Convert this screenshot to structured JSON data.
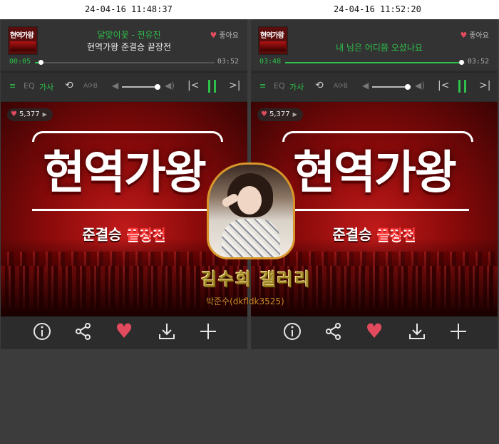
{
  "timestamps": {
    "left": "24-04-16 11:48:37",
    "right": "24-04-16 11:52:20"
  },
  "panels": [
    {
      "thumb": {
        "line1": "현역가왕"
      },
      "line1": "달맞이꽃 - 전유진",
      "line2": "현역가왕 준결승 끝장전",
      "like_label": "좋아요",
      "time_current": "00:05",
      "time_total": "03:52",
      "progress": 0.03,
      "controls": {
        "eq": "EQ",
        "lyrics": "가사",
        "ab": "A⟳B"
      },
      "likes_count": "5,377",
      "art": {
        "title": "현역가왕",
        "sub1": "준결승",
        "sub2": "끝장전"
      }
    },
    {
      "thumb": {
        "line1": "현역가왕"
      },
      "line1": "내 님은 어디쯤 오셨나요",
      "line2": "",
      "like_label": "좋아요",
      "time_current": "03:48",
      "time_total": "03:52",
      "progress": 0.98,
      "controls": {
        "eq": "EQ",
        "lyrics": "가사",
        "ab": "A⟳B"
      },
      "likes_count": "5,377",
      "art": {
        "title": "현역가왕",
        "sub1": "준결승",
        "sub2": "끝장전"
      }
    }
  ],
  "overlay": {
    "title": "김수희 갤러리",
    "id": "박준수(dkfldk3525)"
  },
  "icons": {
    "playlist": "playlist-icon",
    "repeat": "repeat-icon",
    "volume_low": "volume-low-icon",
    "volume_high": "volume-high-icon",
    "prev": "previous-icon",
    "pause": "pause-icon",
    "next": "next-icon",
    "info": "info-icon",
    "share": "share-icon",
    "heart": "heart-icon",
    "download": "download-icon",
    "add": "plus-icon"
  },
  "colors": {
    "accent": "#2ec04a",
    "heart": "#e24b5e",
    "poster": "#8a0a0a"
  }
}
